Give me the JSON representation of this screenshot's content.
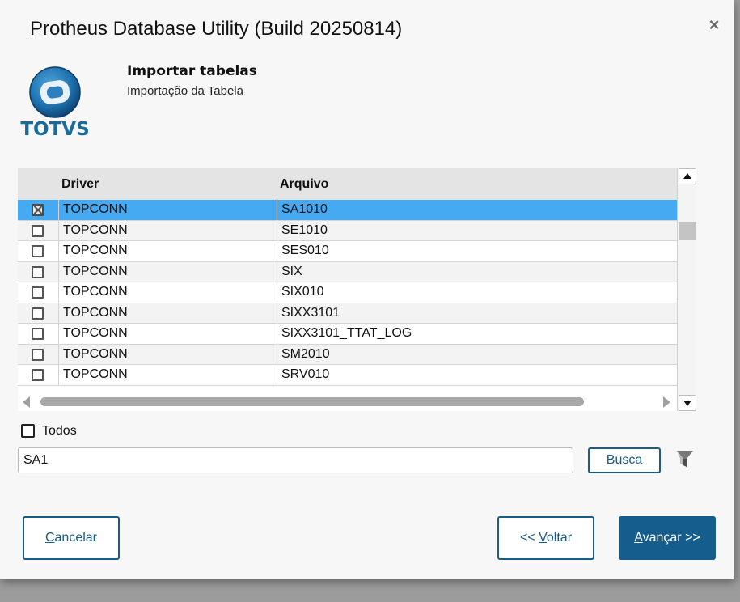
{
  "window": {
    "title": "Protheus Database Utility (Build 20250814)",
    "close_glyph": "×"
  },
  "brand": {
    "logo_text": "TOTVS",
    "logo_color": "#1b6b9a"
  },
  "header": {
    "title": "Importar tabelas",
    "subtitle": "Importação da Tabela"
  },
  "grid": {
    "columns": [
      "Driver",
      "Arquivo"
    ],
    "rows": [
      {
        "checked": true,
        "selected": true,
        "driver": "TOPCONN",
        "arquivo": "SA1010"
      },
      {
        "checked": false,
        "selected": false,
        "driver": "TOPCONN",
        "arquivo": "SE1010"
      },
      {
        "checked": false,
        "selected": false,
        "driver": "TOPCONN",
        "arquivo": "SES010"
      },
      {
        "checked": false,
        "selected": false,
        "driver": "TOPCONN",
        "arquivo": "SIX"
      },
      {
        "checked": false,
        "selected": false,
        "driver": "TOPCONN",
        "arquivo": "SIX010"
      },
      {
        "checked": false,
        "selected": false,
        "driver": "TOPCONN",
        "arquivo": "SIXX3101"
      },
      {
        "checked": false,
        "selected": false,
        "driver": "TOPCONN",
        "arquivo": "SIXX3101_TTAT_LOG"
      },
      {
        "checked": false,
        "selected": false,
        "driver": "TOPCONN",
        "arquivo": "SM2010"
      },
      {
        "checked": false,
        "selected": false,
        "driver": "TOPCONN",
        "arquivo": "SRV010"
      }
    ],
    "selected_color": "#46aaf2"
  },
  "todos": {
    "label": "Todos",
    "checked": false
  },
  "search": {
    "value": "SA1",
    "button_label": "Busca",
    "filter_icon": "filter-icon"
  },
  "footer": {
    "cancel": {
      "underline": "C",
      "rest": "ancelar"
    },
    "back": {
      "prefix": "<< ",
      "underline": "V",
      "rest": "oltar"
    },
    "next": {
      "underline": "A",
      "rest": "vançar >>"
    }
  },
  "colors": {
    "accent": "#1a5c86",
    "primary_button": "#145d8c"
  }
}
